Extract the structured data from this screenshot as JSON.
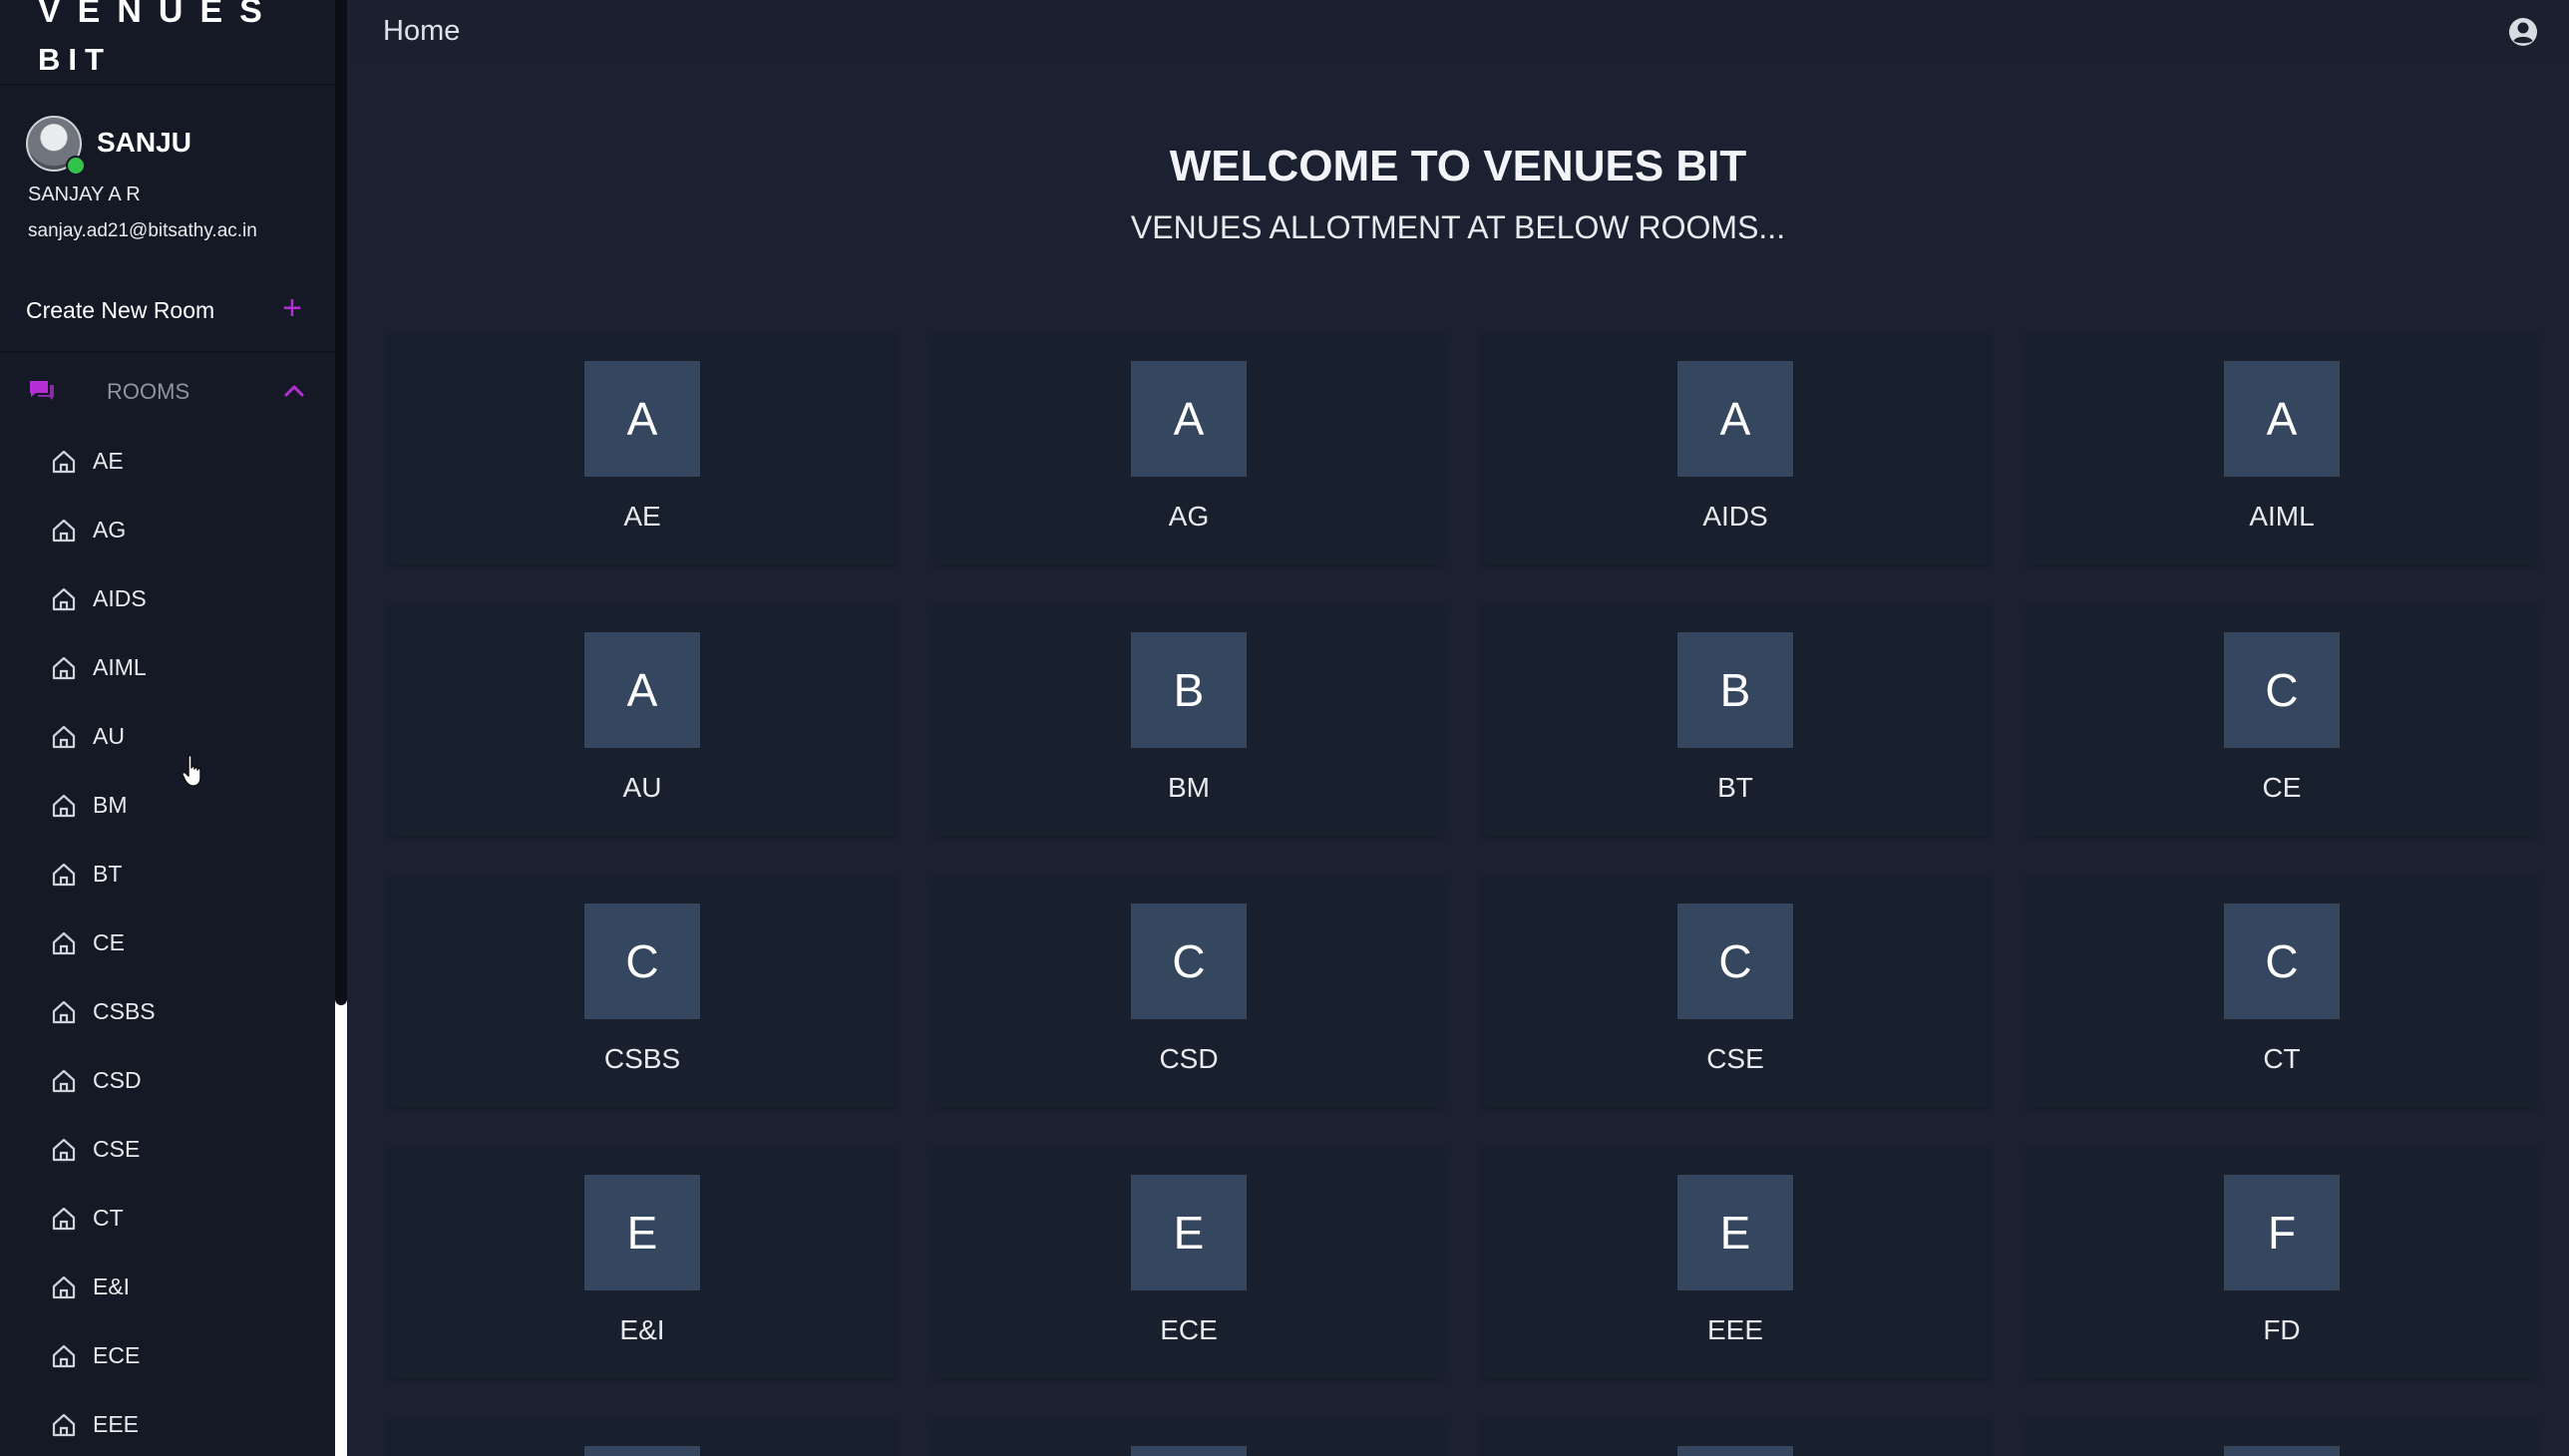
{
  "sidebar": {
    "brand_line1": "VENUES",
    "brand_line2": "BIT",
    "user": {
      "nickname": "SANJU",
      "full_name": "SANJAY A R",
      "email": "sanjay.ad21@bitsathy.ac.in",
      "status": "online"
    },
    "create_room_label": "Create New Room",
    "rooms_label": "ROOMS",
    "rooms_items": [
      "AE",
      "AG",
      "AIDS",
      "AIML",
      "AU",
      "BM",
      "BT",
      "CE",
      "CSBS",
      "CSD",
      "CSE",
      "CT",
      "E&I",
      "ECE",
      "EEE"
    ]
  },
  "header": {
    "title": "Home"
  },
  "main": {
    "welcome_title": "WELCOME TO VENUES BIT",
    "welcome_subtitle": "VENUES ALLOTMENT AT BELOW ROOMS...",
    "rooms": [
      {
        "letter": "A",
        "name": "AE"
      },
      {
        "letter": "A",
        "name": "AG"
      },
      {
        "letter": "A",
        "name": "AIDS"
      },
      {
        "letter": "A",
        "name": "AIML"
      },
      {
        "letter": "A",
        "name": "AU"
      },
      {
        "letter": "B",
        "name": "BM"
      },
      {
        "letter": "B",
        "name": "BT"
      },
      {
        "letter": "C",
        "name": "CE"
      },
      {
        "letter": "C",
        "name": "CSBS"
      },
      {
        "letter": "C",
        "name": "CSD"
      },
      {
        "letter": "C",
        "name": "CSE"
      },
      {
        "letter": "C",
        "name": "CT"
      },
      {
        "letter": "E",
        "name": "E&I"
      },
      {
        "letter": "E",
        "name": "ECE"
      },
      {
        "letter": "E",
        "name": "EEE"
      },
      {
        "letter": "F",
        "name": "FD"
      }
    ]
  },
  "colors": {
    "accent": "#b62fd6",
    "tile": "#34475f",
    "background": "#1b2130",
    "sidebar": "#141925"
  },
  "icons": {
    "room_item": "home-icon",
    "rooms_section": "chat-icon",
    "collapse": "chevron-up-icon",
    "add": "plus-icon",
    "account": "account-circle-icon"
  }
}
